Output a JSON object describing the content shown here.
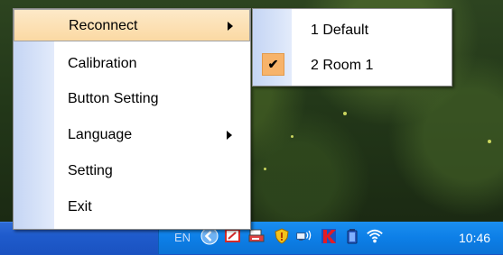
{
  "menu": {
    "items": [
      {
        "label": "Reconnect",
        "has_submenu": true,
        "highlighted": true
      },
      {
        "label": "Calibration",
        "has_submenu": false
      },
      {
        "label": "Button Setting",
        "has_submenu": false
      },
      {
        "label": "Language",
        "has_submenu": true
      },
      {
        "label": "Setting",
        "has_submenu": false
      },
      {
        "label": "Exit",
        "has_submenu": false
      }
    ]
  },
  "submenu": {
    "items": [
      {
        "label": "1 Default",
        "checked": false
      },
      {
        "label": "2 Room 1",
        "checked": true
      }
    ]
  },
  "taskbar": {
    "language": "EN",
    "clock": "10:46",
    "tray_icons": [
      "chevron-left-icon",
      "tablet-icon",
      "printer-icon",
      "shield-icon",
      "network-icon",
      "k-app-icon",
      "battery-icon",
      "wifi-icon"
    ]
  },
  "colors": {
    "highlight": "#fbd9a3",
    "sidebar": "#d6e2f8",
    "check_box": "#f7b36a",
    "taskbar": "#1f5bcc",
    "tray": "#0d7fe7"
  }
}
